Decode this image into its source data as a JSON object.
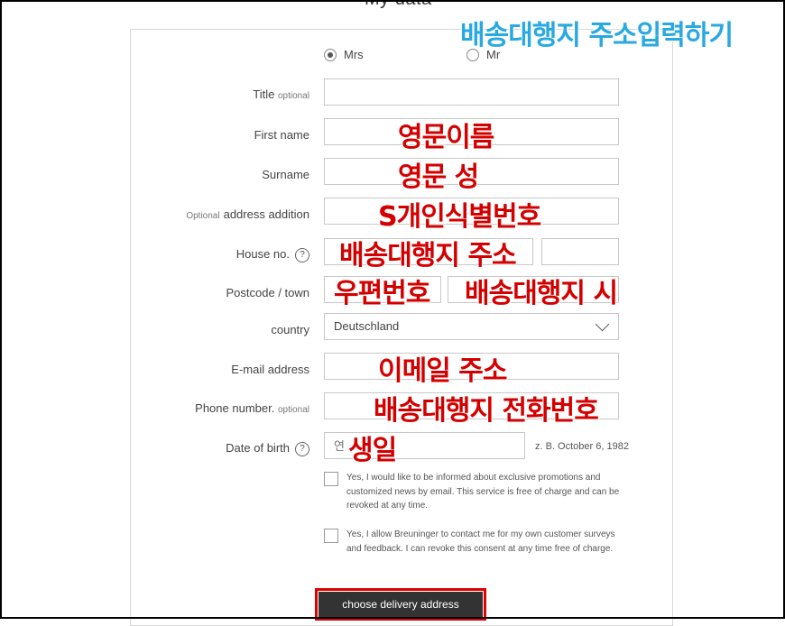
{
  "page_heading": "My data",
  "annotation_title": "배송대행지 주소입력하기",
  "salutation": {
    "option_mrs": "Mrs",
    "option_mr": "Mr",
    "selected": "Mrs"
  },
  "fields": {
    "title": {
      "label": "Title",
      "optional": "optional",
      "value": ""
    },
    "first_name": {
      "label": "First name",
      "value": ""
    },
    "surname": {
      "label": "Surname",
      "value": ""
    },
    "address_addition": {
      "optional": "Optional",
      "label": "address addition",
      "value": ""
    },
    "house_no": {
      "label": "House no.",
      "value": ""
    },
    "postcode_town": {
      "label": "Postcode / town",
      "value": ""
    },
    "country": {
      "label": "country",
      "value": "Deutschland"
    },
    "email": {
      "label": "E-mail address",
      "value": ""
    },
    "phone": {
      "label": "Phone number.",
      "optional": "optional",
      "value": ""
    },
    "dob": {
      "label": "Date of birth",
      "placeholder": "연",
      "hint": "z. B. October 6, 1982"
    }
  },
  "annotations": {
    "first_name": "영문이름",
    "surname": "영문 성",
    "address_addition": "S개인식별번호",
    "street": "배송대행지 주소",
    "postcode": "우편번호",
    "town": "배송대행지 시",
    "email": "이메일 주소",
    "phone": "배송대행지 전화번호",
    "dob": "생일"
  },
  "consents": [
    {
      "text": "Yes, I would like to be informed about exclusive promotions and customized news by email. This service is free of charge and can be revoked at any time."
    },
    {
      "text": "Yes, I allow Breuninger to contact me for my own customer surveys and feedback. I can revoke this consent at any time free of charge."
    }
  ],
  "submit_label": "choose delivery address",
  "help_glyph": "?",
  "colors": {
    "annotation_red": "#d40000",
    "annotation_blue": "#29a9e1",
    "button_bg": "#333333",
    "highlight_border": "#e00000"
  }
}
